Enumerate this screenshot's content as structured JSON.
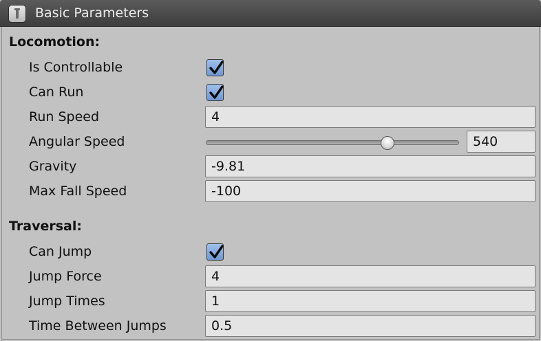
{
  "header": {
    "title": "Basic Parameters",
    "icon": "script-component-icon"
  },
  "locomotion": {
    "title": "Locomotion:",
    "is_controllable": {
      "label": "Is Controllable",
      "checked": true
    },
    "can_run": {
      "label": "Can Run",
      "checked": true
    },
    "run_speed": {
      "label": "Run Speed",
      "value": "4"
    },
    "angular_speed": {
      "label": "Angular Speed",
      "value": "540",
      "slider_fraction": 0.73
    },
    "gravity": {
      "label": "Gravity",
      "value": "-9.81"
    },
    "max_fall_speed": {
      "label": "Max Fall Speed",
      "value": "-100"
    }
  },
  "traversal": {
    "title": "Traversal:",
    "can_jump": {
      "label": "Can Jump",
      "checked": true
    },
    "jump_force": {
      "label": "Jump Force",
      "value": "4"
    },
    "jump_times": {
      "label": "Jump Times",
      "value": "1"
    },
    "time_between_jumps": {
      "label": "Time Between Jumps",
      "value": "0.5"
    }
  },
  "colors": {
    "panel_bg": "#c2c2c2",
    "header_bg": "#4a4a4a",
    "checkbox_fill": "#7fa5dc",
    "field_bg": "#e4e4e4"
  }
}
